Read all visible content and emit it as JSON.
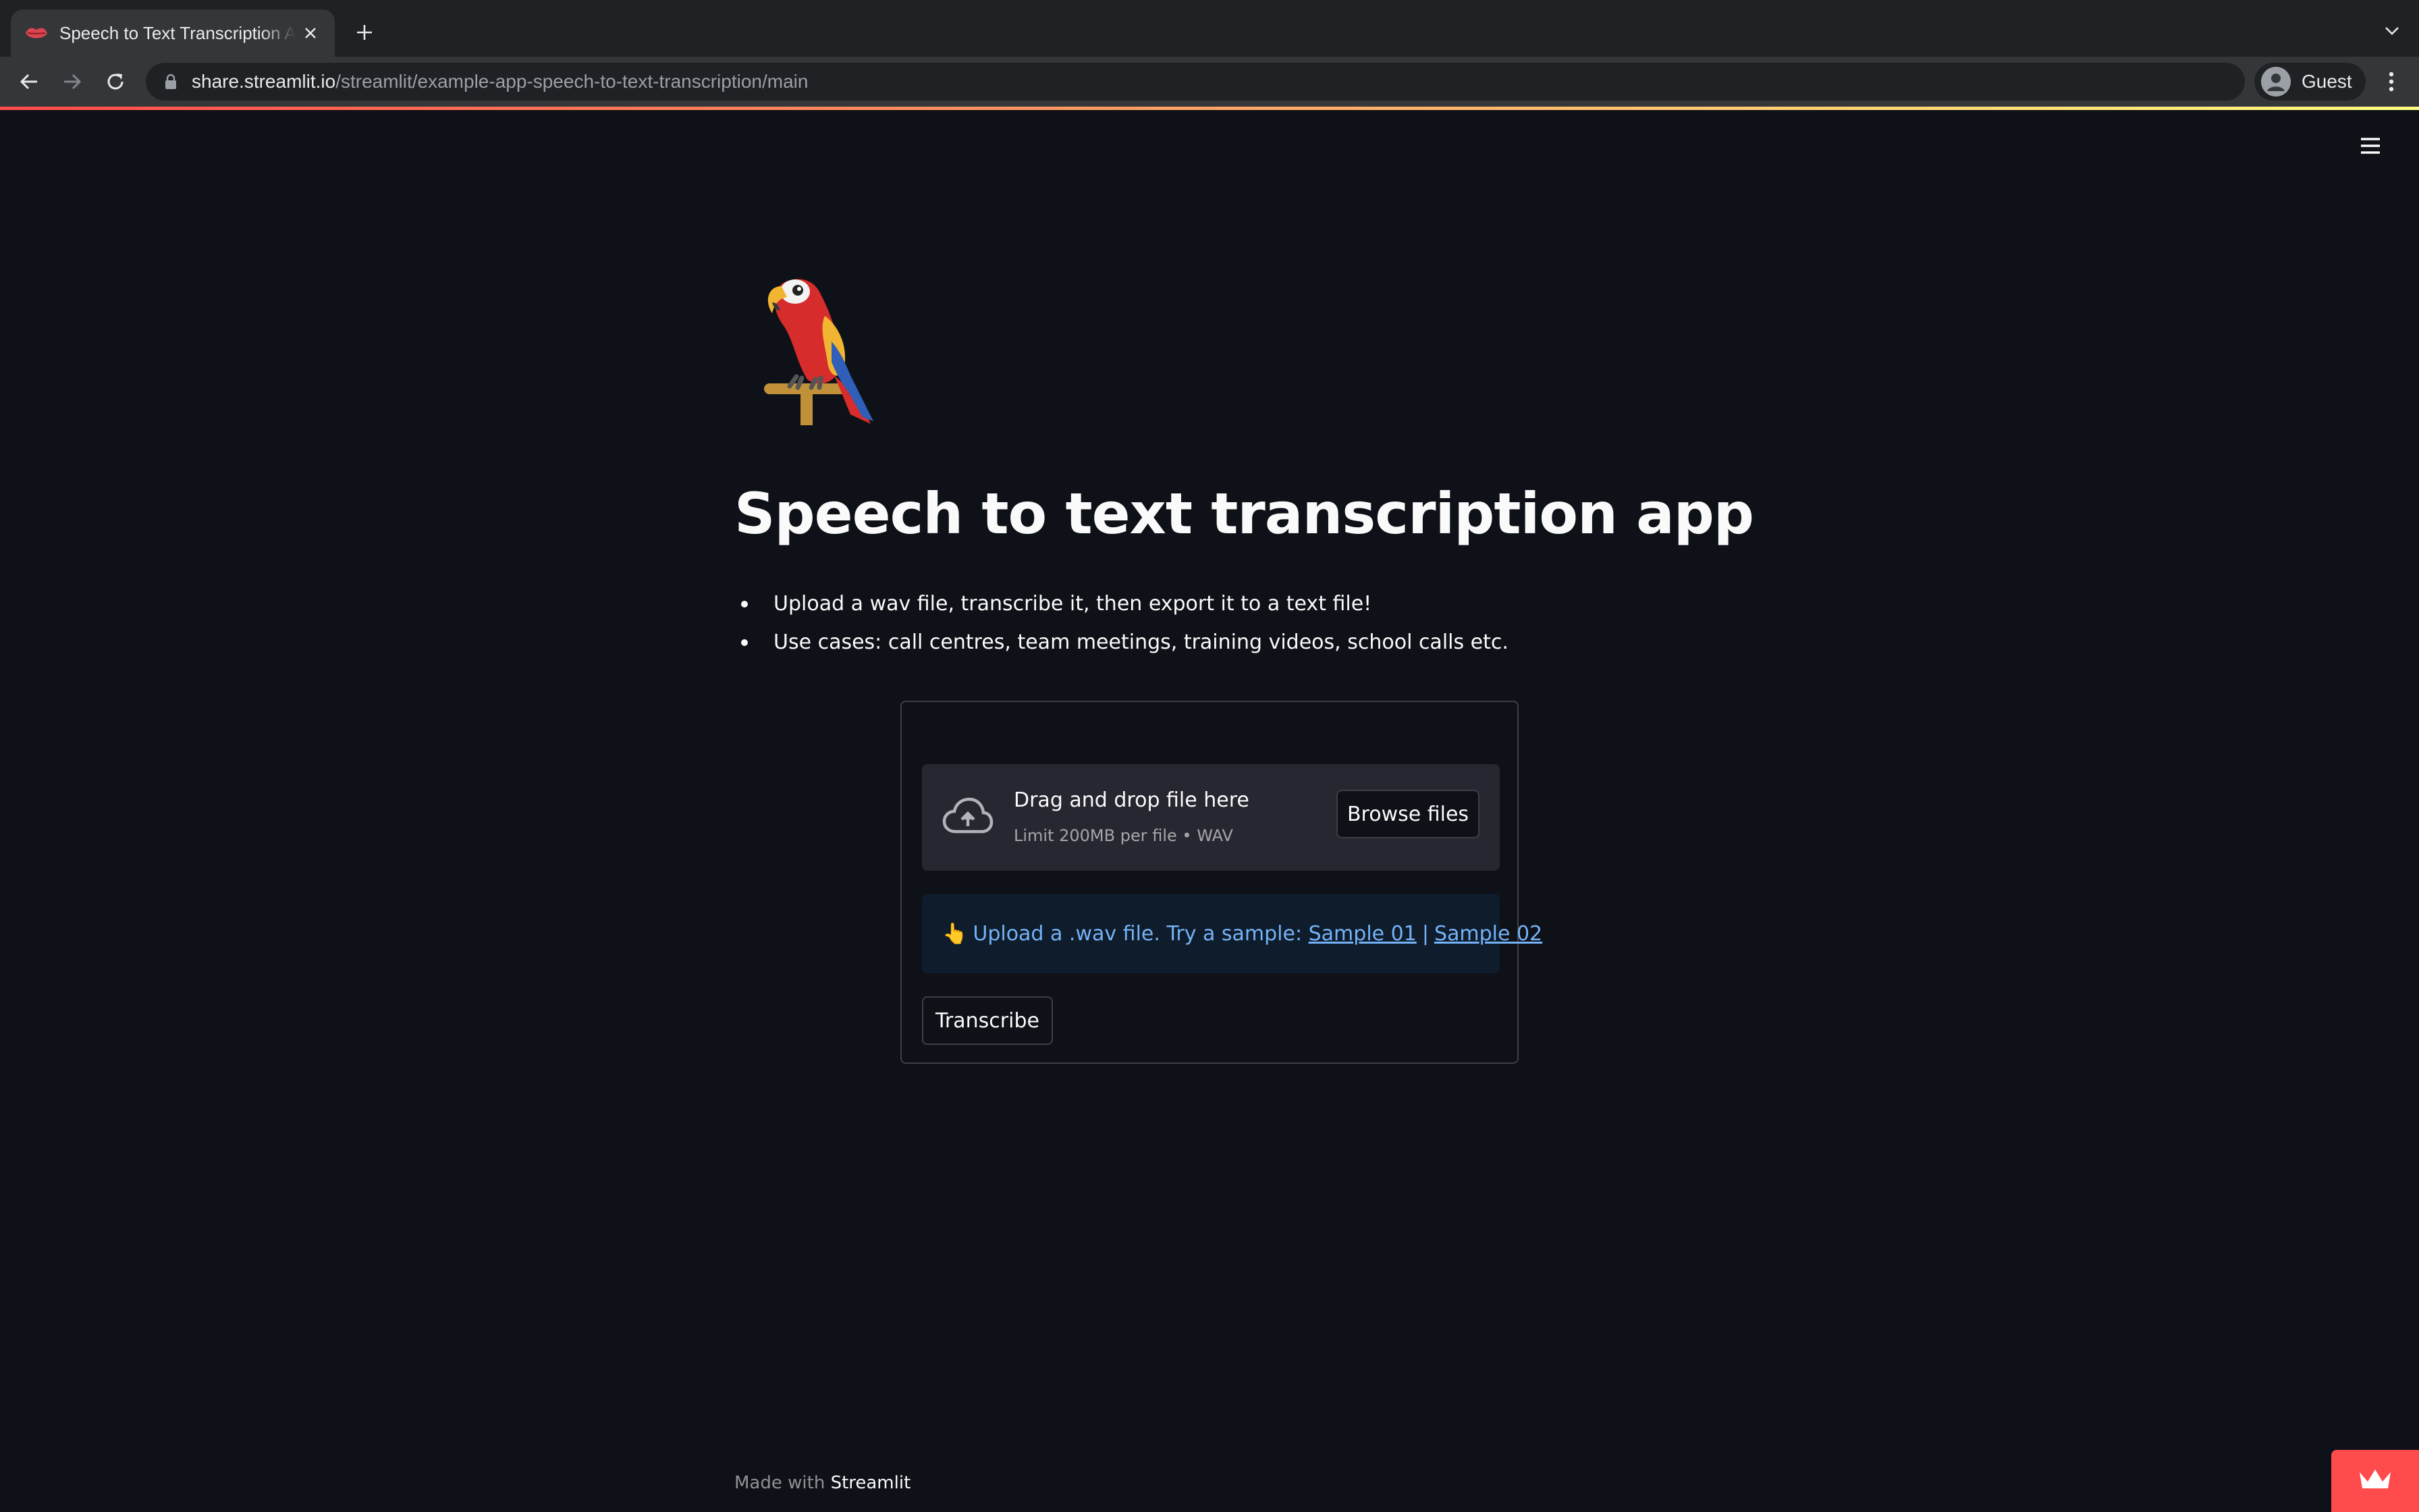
{
  "browser": {
    "tab_title": "Speech to Text Transcription App",
    "url_host": "share.streamlit.io",
    "url_path": "/streamlit/example-app-speech-to-text-transcription/main",
    "profile_label": "Guest"
  },
  "page": {
    "logo_icon": "parrot-icon",
    "title": "Speech to text transcription app",
    "bullets": [
      "Upload a wav file, transcribe it, then export it to a text file!",
      "Use cases: call centres, team meetings, training videos, school calls etc."
    ]
  },
  "uploader": {
    "drag_text": "Drag and drop file here",
    "limit_text": "Limit 200MB per file • WAV",
    "browse_label": "Browse files"
  },
  "info": {
    "emoji": "👆",
    "text": "Upload a .wav file. Try a sample: ",
    "sample1": "Sample 01",
    "separator": "|",
    "sample2": "Sample 02"
  },
  "transcribe_label": "Transcribe",
  "footer": {
    "prefix": "Made with ",
    "brand": "Streamlit"
  },
  "colors": {
    "background": "#0e1117",
    "accent": "#ff4b4b",
    "info_text": "#74b3f7"
  }
}
